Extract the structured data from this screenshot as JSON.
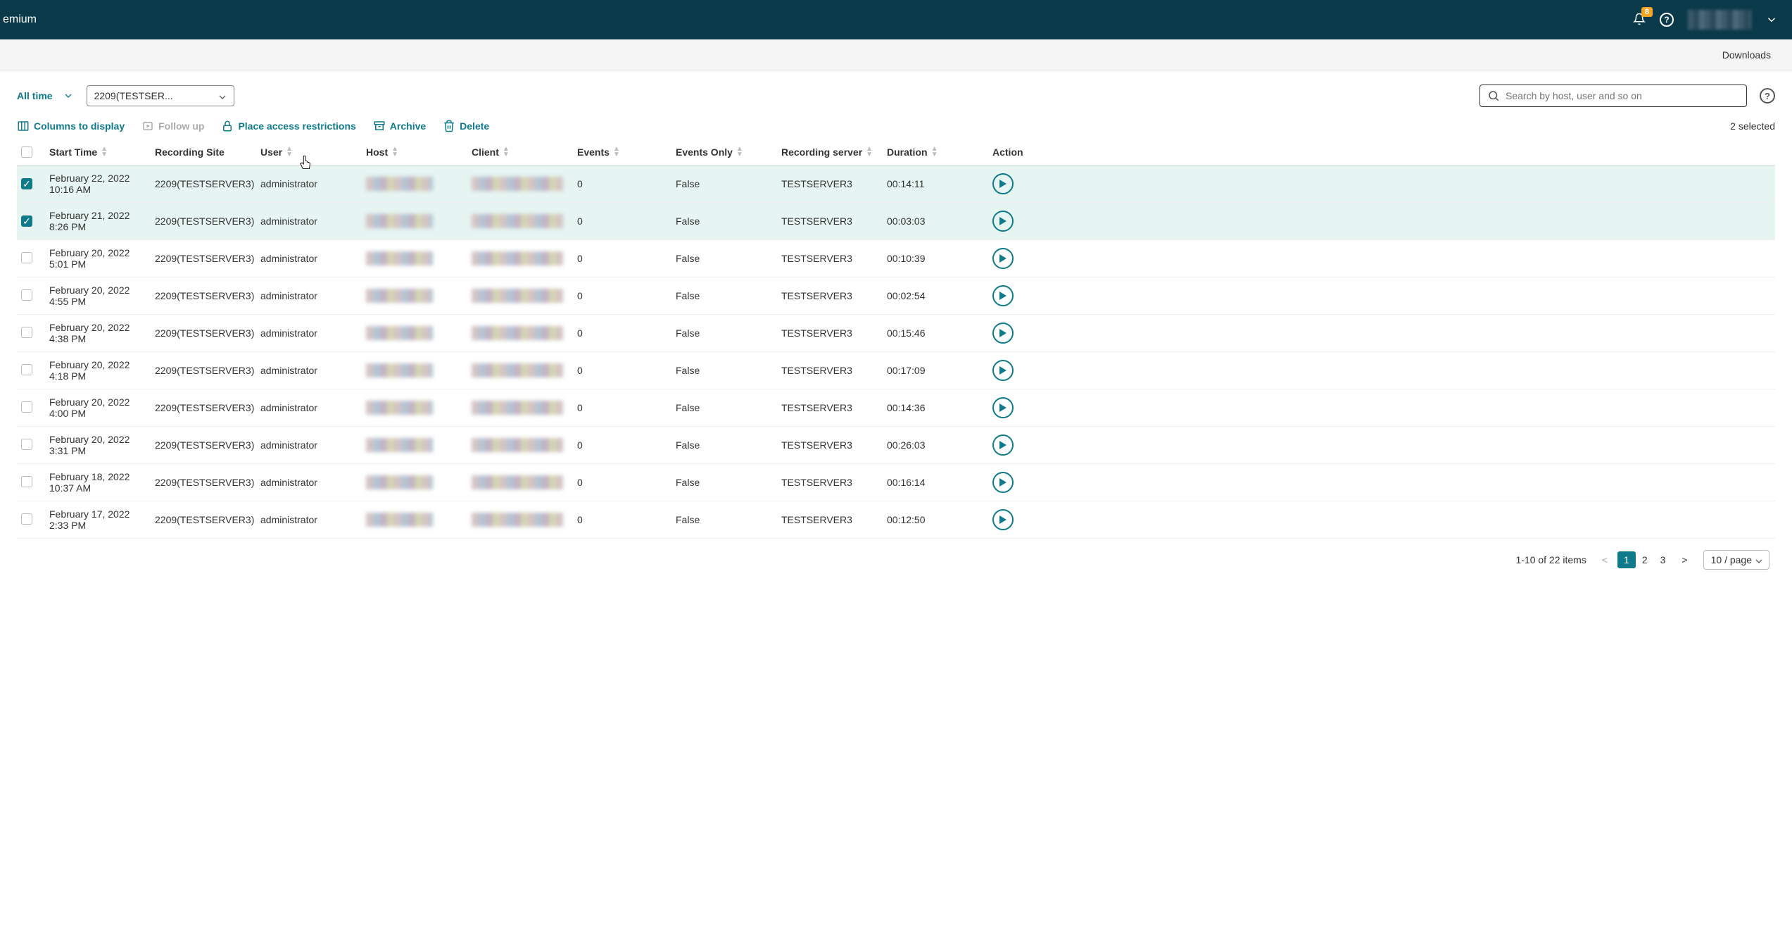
{
  "topbar": {
    "title_fragment": "emium",
    "notification_count": "8"
  },
  "subbar": {
    "downloads_label": "Downloads"
  },
  "filters": {
    "time_label": "All time",
    "server_selected": "2209(TESTSER...",
    "search_placeholder": "Search by host, user and so on"
  },
  "actions": {
    "columns": "Columns to display",
    "followup": "Follow up",
    "restrict": "Place access restrictions",
    "archive": "Archive",
    "delete": "Delete",
    "selected_text": "2 selected"
  },
  "columns": {
    "start_time": "Start Time",
    "recording_site": "Recording Site",
    "user": "User",
    "host": "Host",
    "client": "Client",
    "events": "Events",
    "events_only": "Events Only",
    "recording_server": "Recording server",
    "duration": "Duration",
    "action": "Action"
  },
  "rows": [
    {
      "selected": true,
      "start_date": "February 22, 2022",
      "start_time": "10:16 AM",
      "site": "2209(TESTSERVER3)",
      "user": "administrator",
      "events": "0",
      "events_only": "False",
      "server": "TESTSERVER3",
      "duration": "00:14:11"
    },
    {
      "selected": true,
      "start_date": "February 21, 2022",
      "start_time": "8:26 PM",
      "site": "2209(TESTSERVER3)",
      "user": "administrator",
      "events": "0",
      "events_only": "False",
      "server": "TESTSERVER3",
      "duration": "00:03:03"
    },
    {
      "selected": false,
      "start_date": "February 20, 2022",
      "start_time": "5:01 PM",
      "site": "2209(TESTSERVER3)",
      "user": "administrator",
      "events": "0",
      "events_only": "False",
      "server": "TESTSERVER3",
      "duration": "00:10:39"
    },
    {
      "selected": false,
      "start_date": "February 20, 2022",
      "start_time": "4:55 PM",
      "site": "2209(TESTSERVER3)",
      "user": "administrator",
      "events": "0",
      "events_only": "False",
      "server": "TESTSERVER3",
      "duration": "00:02:54"
    },
    {
      "selected": false,
      "start_date": "February 20, 2022",
      "start_time": "4:38 PM",
      "site": "2209(TESTSERVER3)",
      "user": "administrator",
      "events": "0",
      "events_only": "False",
      "server": "TESTSERVER3",
      "duration": "00:15:46"
    },
    {
      "selected": false,
      "start_date": "February 20, 2022",
      "start_time": "4:18 PM",
      "site": "2209(TESTSERVER3)",
      "user": "administrator",
      "events": "0",
      "events_only": "False",
      "server": "TESTSERVER3",
      "duration": "00:17:09"
    },
    {
      "selected": false,
      "start_date": "February 20, 2022",
      "start_time": "4:00 PM",
      "site": "2209(TESTSERVER3)",
      "user": "administrator",
      "events": "0",
      "events_only": "False",
      "server": "TESTSERVER3",
      "duration": "00:14:36"
    },
    {
      "selected": false,
      "start_date": "February 20, 2022",
      "start_time": "3:31 PM",
      "site": "2209(TESTSERVER3)",
      "user": "administrator",
      "events": "0",
      "events_only": "False",
      "server": "TESTSERVER3",
      "duration": "00:26:03"
    },
    {
      "selected": false,
      "start_date": "February 18, 2022",
      "start_time": "10:37 AM",
      "site": "2209(TESTSERVER3)",
      "user": "administrator",
      "events": "0",
      "events_only": "False",
      "server": "TESTSERVER3",
      "duration": "00:16:14"
    },
    {
      "selected": false,
      "start_date": "February 17, 2022",
      "start_time": "2:33 PM",
      "site": "2209(TESTSERVER3)",
      "user": "administrator",
      "events": "0",
      "events_only": "False",
      "server": "TESTSERVER3",
      "duration": "00:12:50"
    }
  ],
  "footer": {
    "range_text": "1-10 of 22 items",
    "pages": [
      "1",
      "2",
      "3"
    ],
    "active_page": "1",
    "page_size_label": "10 / page"
  }
}
